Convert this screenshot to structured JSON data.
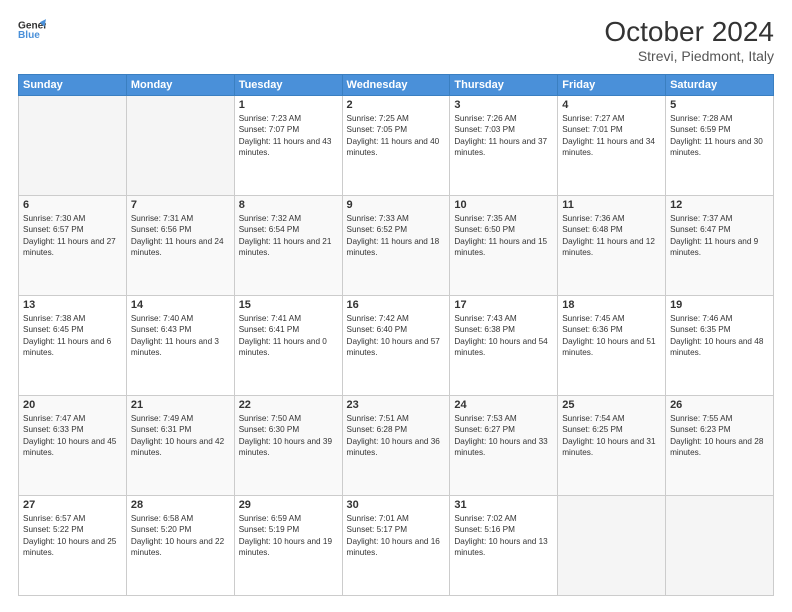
{
  "header": {
    "logo_line1": "General",
    "logo_line2": "Blue",
    "title": "October 2024",
    "subtitle": "Strevi, Piedmont, Italy"
  },
  "weekdays": [
    "Sunday",
    "Monday",
    "Tuesday",
    "Wednesday",
    "Thursday",
    "Friday",
    "Saturday"
  ],
  "weeks": [
    [
      {
        "day": "",
        "sunrise": "",
        "sunset": "",
        "daylight": "",
        "empty": true
      },
      {
        "day": "",
        "sunrise": "",
        "sunset": "",
        "daylight": "",
        "empty": true
      },
      {
        "day": "1",
        "sunrise": "Sunrise: 7:23 AM",
        "sunset": "Sunset: 7:07 PM",
        "daylight": "Daylight: 11 hours and 43 minutes."
      },
      {
        "day": "2",
        "sunrise": "Sunrise: 7:25 AM",
        "sunset": "Sunset: 7:05 PM",
        "daylight": "Daylight: 11 hours and 40 minutes."
      },
      {
        "day": "3",
        "sunrise": "Sunrise: 7:26 AM",
        "sunset": "Sunset: 7:03 PM",
        "daylight": "Daylight: 11 hours and 37 minutes."
      },
      {
        "day": "4",
        "sunrise": "Sunrise: 7:27 AM",
        "sunset": "Sunset: 7:01 PM",
        "daylight": "Daylight: 11 hours and 34 minutes."
      },
      {
        "day": "5",
        "sunrise": "Sunrise: 7:28 AM",
        "sunset": "Sunset: 6:59 PM",
        "daylight": "Daylight: 11 hours and 30 minutes."
      }
    ],
    [
      {
        "day": "6",
        "sunrise": "Sunrise: 7:30 AM",
        "sunset": "Sunset: 6:57 PM",
        "daylight": "Daylight: 11 hours and 27 minutes."
      },
      {
        "day": "7",
        "sunrise": "Sunrise: 7:31 AM",
        "sunset": "Sunset: 6:56 PM",
        "daylight": "Daylight: 11 hours and 24 minutes."
      },
      {
        "day": "8",
        "sunrise": "Sunrise: 7:32 AM",
        "sunset": "Sunset: 6:54 PM",
        "daylight": "Daylight: 11 hours and 21 minutes."
      },
      {
        "day": "9",
        "sunrise": "Sunrise: 7:33 AM",
        "sunset": "Sunset: 6:52 PM",
        "daylight": "Daylight: 11 hours and 18 minutes."
      },
      {
        "day": "10",
        "sunrise": "Sunrise: 7:35 AM",
        "sunset": "Sunset: 6:50 PM",
        "daylight": "Daylight: 11 hours and 15 minutes."
      },
      {
        "day": "11",
        "sunrise": "Sunrise: 7:36 AM",
        "sunset": "Sunset: 6:48 PM",
        "daylight": "Daylight: 11 hours and 12 minutes."
      },
      {
        "day": "12",
        "sunrise": "Sunrise: 7:37 AM",
        "sunset": "Sunset: 6:47 PM",
        "daylight": "Daylight: 11 hours and 9 minutes."
      }
    ],
    [
      {
        "day": "13",
        "sunrise": "Sunrise: 7:38 AM",
        "sunset": "Sunset: 6:45 PM",
        "daylight": "Daylight: 11 hours and 6 minutes."
      },
      {
        "day": "14",
        "sunrise": "Sunrise: 7:40 AM",
        "sunset": "Sunset: 6:43 PM",
        "daylight": "Daylight: 11 hours and 3 minutes."
      },
      {
        "day": "15",
        "sunrise": "Sunrise: 7:41 AM",
        "sunset": "Sunset: 6:41 PM",
        "daylight": "Daylight: 11 hours and 0 minutes."
      },
      {
        "day": "16",
        "sunrise": "Sunrise: 7:42 AM",
        "sunset": "Sunset: 6:40 PM",
        "daylight": "Daylight: 10 hours and 57 minutes."
      },
      {
        "day": "17",
        "sunrise": "Sunrise: 7:43 AM",
        "sunset": "Sunset: 6:38 PM",
        "daylight": "Daylight: 10 hours and 54 minutes."
      },
      {
        "day": "18",
        "sunrise": "Sunrise: 7:45 AM",
        "sunset": "Sunset: 6:36 PM",
        "daylight": "Daylight: 10 hours and 51 minutes."
      },
      {
        "day": "19",
        "sunrise": "Sunrise: 7:46 AM",
        "sunset": "Sunset: 6:35 PM",
        "daylight": "Daylight: 10 hours and 48 minutes."
      }
    ],
    [
      {
        "day": "20",
        "sunrise": "Sunrise: 7:47 AM",
        "sunset": "Sunset: 6:33 PM",
        "daylight": "Daylight: 10 hours and 45 minutes."
      },
      {
        "day": "21",
        "sunrise": "Sunrise: 7:49 AM",
        "sunset": "Sunset: 6:31 PM",
        "daylight": "Daylight: 10 hours and 42 minutes."
      },
      {
        "day": "22",
        "sunrise": "Sunrise: 7:50 AM",
        "sunset": "Sunset: 6:30 PM",
        "daylight": "Daylight: 10 hours and 39 minutes."
      },
      {
        "day": "23",
        "sunrise": "Sunrise: 7:51 AM",
        "sunset": "Sunset: 6:28 PM",
        "daylight": "Daylight: 10 hours and 36 minutes."
      },
      {
        "day": "24",
        "sunrise": "Sunrise: 7:53 AM",
        "sunset": "Sunset: 6:27 PM",
        "daylight": "Daylight: 10 hours and 33 minutes."
      },
      {
        "day": "25",
        "sunrise": "Sunrise: 7:54 AM",
        "sunset": "Sunset: 6:25 PM",
        "daylight": "Daylight: 10 hours and 31 minutes."
      },
      {
        "day": "26",
        "sunrise": "Sunrise: 7:55 AM",
        "sunset": "Sunset: 6:23 PM",
        "daylight": "Daylight: 10 hours and 28 minutes."
      }
    ],
    [
      {
        "day": "27",
        "sunrise": "Sunrise: 6:57 AM",
        "sunset": "Sunset: 5:22 PM",
        "daylight": "Daylight: 10 hours and 25 minutes."
      },
      {
        "day": "28",
        "sunrise": "Sunrise: 6:58 AM",
        "sunset": "Sunset: 5:20 PM",
        "daylight": "Daylight: 10 hours and 22 minutes."
      },
      {
        "day": "29",
        "sunrise": "Sunrise: 6:59 AM",
        "sunset": "Sunset: 5:19 PM",
        "daylight": "Daylight: 10 hours and 19 minutes."
      },
      {
        "day": "30",
        "sunrise": "Sunrise: 7:01 AM",
        "sunset": "Sunset: 5:17 PM",
        "daylight": "Daylight: 10 hours and 16 minutes."
      },
      {
        "day": "31",
        "sunrise": "Sunrise: 7:02 AM",
        "sunset": "Sunset: 5:16 PM",
        "daylight": "Daylight: 10 hours and 13 minutes."
      },
      {
        "day": "",
        "sunrise": "",
        "sunset": "",
        "daylight": "",
        "empty": true
      },
      {
        "day": "",
        "sunrise": "",
        "sunset": "",
        "daylight": "",
        "empty": true
      }
    ]
  ]
}
